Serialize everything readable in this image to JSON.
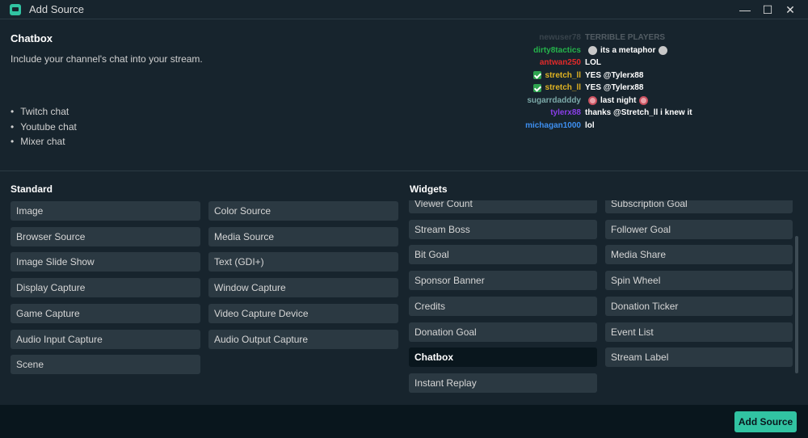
{
  "window": {
    "title": "Add Source",
    "controls": {
      "minimize": "—",
      "maximize": "☐",
      "close": "✕"
    }
  },
  "description": {
    "title": "Chatbox",
    "subtitle": "Include your channel's chat into your stream.",
    "features": [
      "Twitch chat",
      "Youtube chat",
      "Mixer chat"
    ]
  },
  "chat_preview": [
    {
      "user": "newuser78",
      "user_color": "#9aa0a6",
      "message": "TERRIBLE PLAYERS",
      "faded": true
    },
    {
      "user": "dirty8tactics",
      "user_color": "#25b34b",
      "message": "its a metaphor",
      "emote_before": true,
      "emote_after": true
    },
    {
      "user": "antwan250",
      "user_color": "#e22a2a",
      "message": "LOL"
    },
    {
      "user": "stretch_ll",
      "user_color": "#e0b322",
      "message": "YES @Tylerx88",
      "badge": true
    },
    {
      "user": "stretch_ll",
      "user_color": "#e0b322",
      "message": "YES @Tylerx88",
      "badge": true
    },
    {
      "user": "sugarrdadddy",
      "user_color": "#7ca9a8",
      "message": "last night",
      "emote_pink_before": true,
      "emote_pink_after": true
    },
    {
      "user": "tylerx88",
      "user_color": "#8a3ee8",
      "message": "thanks @Stretch_ll i knew it"
    },
    {
      "user": "michagan1000",
      "user_color": "#3e8ff0",
      "message": "lol"
    }
  ],
  "standard": {
    "label": "Standard",
    "left": [
      "Image",
      "Browser Source",
      "Image Slide Show",
      "Display Capture",
      "Game Capture",
      "Audio Input Capture",
      "Scene"
    ],
    "right": [
      "Color Source",
      "Media Source",
      "Text (GDI+)",
      "Window Capture",
      "Video Capture Device",
      "Audio Output Capture"
    ]
  },
  "widgets": {
    "label": "Widgets",
    "left": [
      "Viewer Count",
      "Stream Boss",
      "Bit Goal",
      "Sponsor Banner",
      "Credits",
      "Donation Goal",
      "Chatbox",
      "Instant Replay"
    ],
    "right": [
      "Subscription Goal",
      "Follower Goal",
      "Media Share",
      "Spin Wheel",
      "Donation Ticker",
      "Event List",
      "Stream Label"
    ],
    "selected": "Chatbox"
  },
  "footer": {
    "add_label": "Add Source"
  },
  "colors": {
    "accent": "#31c3a2",
    "background": "#17242d",
    "button": "#2b3942",
    "footer": "#09161d"
  }
}
